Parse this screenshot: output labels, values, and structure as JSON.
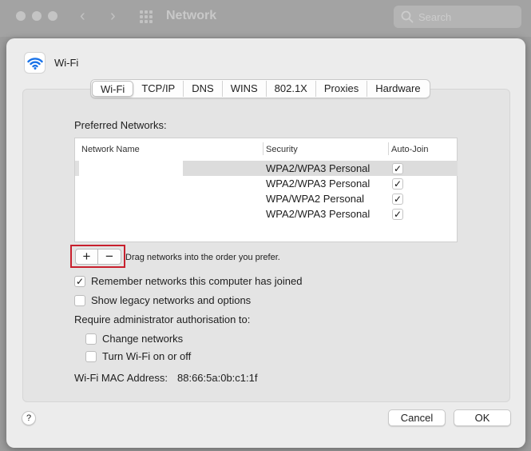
{
  "window": {
    "title": "Network",
    "search_placeholder": "Search"
  },
  "sheet": {
    "title": "Wi-Fi",
    "icon": "wifi-icon"
  },
  "tabs": [
    {
      "label": "Wi-Fi",
      "active": true
    },
    {
      "label": "TCP/IP",
      "active": false
    },
    {
      "label": "DNS",
      "active": false
    },
    {
      "label": "WINS",
      "active": false
    },
    {
      "label": "802.1X",
      "active": false
    },
    {
      "label": "Proxies",
      "active": false
    },
    {
      "label": "Hardware",
      "active": false
    }
  ],
  "preferred": {
    "label": "Preferred Networks:",
    "columns": {
      "name": "Network Name",
      "security": "Security",
      "auto_join": "Auto-Join"
    },
    "rows": [
      {
        "name": "",
        "security": "WPA2/WPA3 Personal",
        "auto_join": true,
        "selected": true
      },
      {
        "name": "",
        "security": "WPA2/WPA3 Personal",
        "auto_join": true,
        "selected": false
      },
      {
        "name": "",
        "security": "WPA/WPA2 Personal",
        "auto_join": true,
        "selected": false
      },
      {
        "name": "",
        "security": "WPA2/WPA3 Personal",
        "auto_join": true,
        "selected": false
      }
    ],
    "add_label": "+",
    "remove_label": "−",
    "drag_hint": "Drag networks into the order you prefer."
  },
  "options": {
    "remember": {
      "label": "Remember networks this computer has joined",
      "checked": true
    },
    "legacy": {
      "label": "Show legacy networks and options",
      "checked": false
    },
    "admin_label": "Require administrator authorisation to:",
    "change_networks": {
      "label": "Change networks",
      "checked": false
    },
    "toggle_wifi": {
      "label": "Turn Wi-Fi on or off",
      "checked": false
    }
  },
  "mac": {
    "label": "Wi-Fi MAC Address:",
    "value": "88:66:5a:0b:c1:1f"
  },
  "footer": {
    "help_label": "?",
    "cancel_label": "Cancel",
    "ok_label": "OK"
  },
  "colors": {
    "highlight_border": "#c8202d",
    "wifi_blue": "#1a73e8"
  }
}
